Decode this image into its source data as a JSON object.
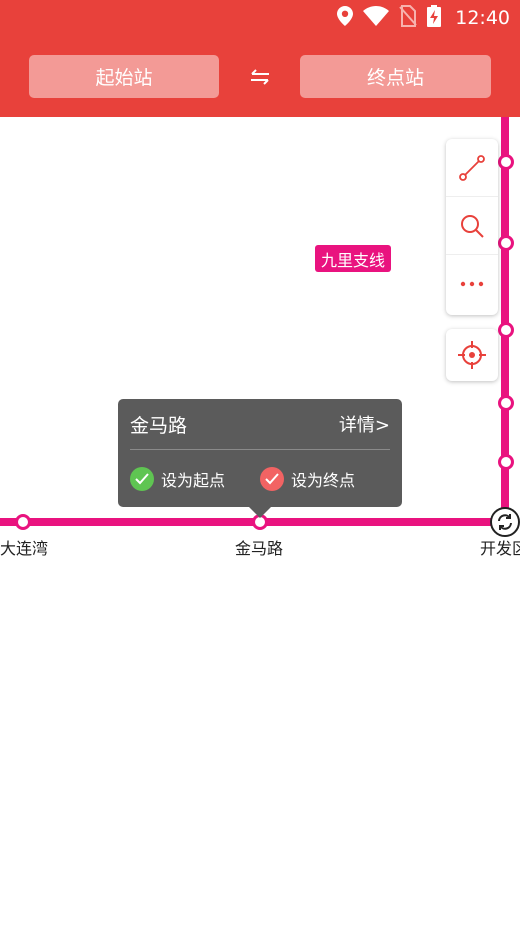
{
  "status_bar": {
    "time": "12:40",
    "icons": [
      "location-icon",
      "wifi-icon",
      "no-sim-icon",
      "battery-charging-icon"
    ]
  },
  "header": {
    "start_placeholder": "起始站",
    "end_placeholder": "终点站",
    "swap_icon": "swap-arrows-icon",
    "color": "#e8413b"
  },
  "map": {
    "line_color": "#e9137f",
    "branch_tag": "九里支线",
    "stations": [
      {
        "label": "大连湾"
      },
      {
        "label": "金马路"
      },
      {
        "label": "开发区"
      }
    ]
  },
  "toolbar": {
    "items": [
      "route-icon",
      "search-icon",
      "more-icon"
    ],
    "locate": "locate-icon"
  },
  "popup": {
    "station": "金马路",
    "detail": "详情>",
    "set_start": "设为起点",
    "set_end": "设为终点",
    "start_color": "#5fc552",
    "end_color": "#f26363"
  }
}
